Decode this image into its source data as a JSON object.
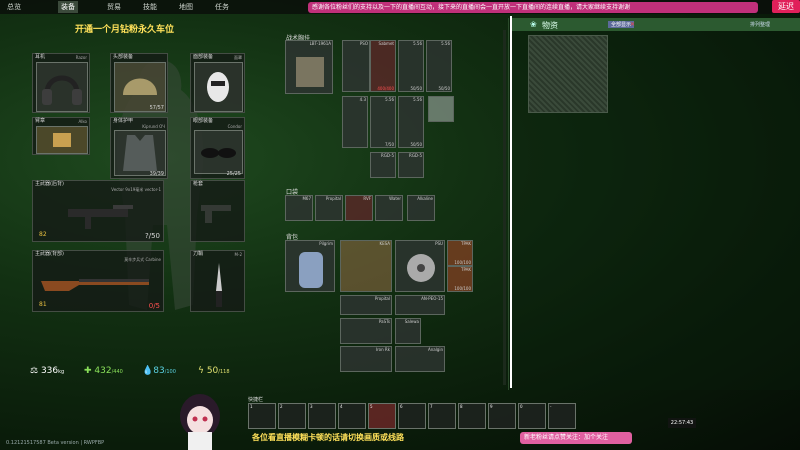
{
  "topnav": {
    "tabs": [
      {
        "label": "总览",
        "active": false
      },
      {
        "label": "装备",
        "active": true
      },
      {
        "label": "贸易",
        "active": false
      },
      {
        "label": "技能",
        "active": false
      },
      {
        "label": "地图",
        "active": false
      },
      {
        "label": "任务",
        "active": false
      }
    ]
  },
  "banner": {
    "text": "感谢各位粉丝们的支持以及一下的直播间互动，接下来的直播间会一直开放一下直播间的连续直播，请大家继续支持谢谢"
  },
  "delay_badge": "延迟",
  "promo": "开通一个月钻粉永久车位",
  "left": {
    "slots": [
      {
        "id": "earpiece",
        "label": "耳机",
        "name": "Razor"
      },
      {
        "id": "headwear",
        "label": "头部装备",
        "name": "",
        "durability": "57/57"
      },
      {
        "id": "facecover",
        "label": "面部装备",
        "name": "面罩"
      },
      {
        "id": "armband",
        "label": "臂章",
        "name": "Alko"
      },
      {
        "id": "bodyarmor",
        "label": "身体护甲",
        "name": "Kiprund ОЧ",
        "durability": "39/39"
      },
      {
        "id": "eyewear",
        "label": "眼部装备",
        "name": "Condor",
        "durability": "25/25"
      },
      {
        "id": "primary",
        "label": "主武器(后背)",
        "name": "Vector 9x19毫米 vector-1",
        "ammo": "?/50"
      },
      {
        "id": "holster",
        "label": "枪套",
        "name": ""
      },
      {
        "id": "secondary",
        "label": "主武器(背部)",
        "name": "莫辛步兵式 Carbine",
        "ammo": "0/5"
      },
      {
        "id": "melee",
        "label": "刀鞘",
        "name": "M-2"
      }
    ],
    "primary_level": "82",
    "secondary_level": "81",
    "stats": [
      {
        "id": "weight",
        "value": "336",
        "unit": "kg"
      },
      {
        "id": "health",
        "value": "432",
        "max": "/440"
      },
      {
        "id": "hydration",
        "value": "83",
        "max": "/100"
      },
      {
        "id": "energy",
        "value": "50",
        "max": "/118"
      }
    ]
  },
  "rig": {
    "section_rig": "战术胸挂",
    "rig_name": "LBT-1961A",
    "cells": [
      {
        "t": "PSO",
        "v": ""
      },
      {
        "t": "Sabmet",
        "v": "400/400"
      },
      {
        "t": "5.56",
        "v": "50/50"
      },
      {
        "t": "5.56",
        "v": "50/50"
      },
      {
        "t": "4.3",
        "v": ""
      },
      {
        "t": "5.56",
        "v": "7/50"
      },
      {
        "t": "5.56",
        "v": "50/50"
      },
      {
        "t": "RGD-5",
        "v": ""
      },
      {
        "t": "RGD-5",
        "v": ""
      }
    ],
    "section_pockets": "口袋",
    "pockets": [
      {
        "t": "M67",
        "v": ""
      },
      {
        "t": "Propital",
        "v": ""
      },
      {
        "t": "RVF",
        "v": ""
      },
      {
        "t": "Water",
        "v": ""
      },
      {
        "t": "Alkaline",
        "v": ""
      }
    ],
    "section_backpack": "背包",
    "backpack_name": "Pilgrim",
    "backpack_items": [
      {
        "t": "KESA",
        "v": ""
      },
      {
        "t": "PSU",
        "v": ""
      },
      {
        "t": "TPAK",
        "v": "100/100"
      },
      {
        "t": "TPAK",
        "v": "100/100"
      },
      {
        "t": "Propital",
        "v": ""
      },
      {
        "t": "AN-PEO-15",
        "v": ""
      },
      {
        "t": "PaSTs",
        "v": ""
      },
      {
        "t": "Salewa",
        "v": ""
      },
      {
        "t": "Iron Rk",
        "v": ""
      },
      {
        "t": "Analgin",
        "v": ""
      }
    ]
  },
  "loot": {
    "title": "物资",
    "tag": "全部显示",
    "right_label": "排列整理"
  },
  "quickbar": {
    "slots": [
      "1",
      "2",
      "3",
      "4",
      "5",
      "6",
      "7",
      "8",
      "9",
      "0",
      "-",
      "="
    ],
    "title": "快捷栏"
  },
  "clock": "22:57:43",
  "caption": "各位看直播模糊卡顿的话请切换画质或线路",
  "version": "0.12121517587 Beta version | RWPFBP",
  "bottom_badge": "新老粉丝请点赞关注：加个关注"
}
